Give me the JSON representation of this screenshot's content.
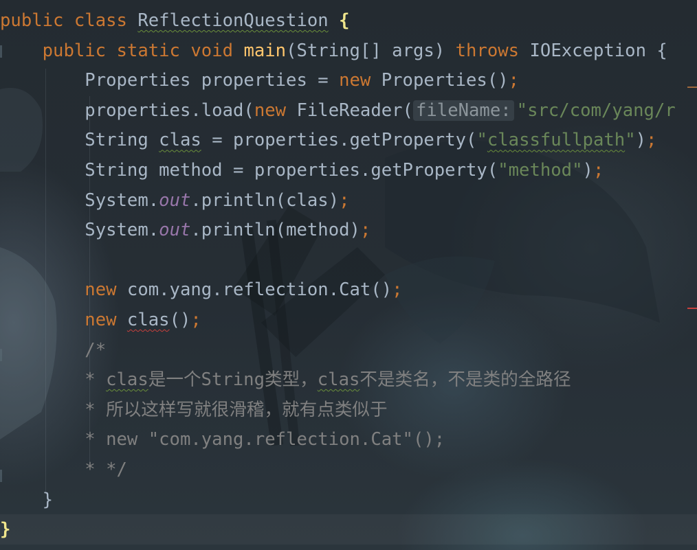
{
  "editor": {
    "lines": [
      {
        "indent": "",
        "tokens": [
          {
            "t": "public ",
            "c": "kw"
          },
          {
            "t": "class ",
            "c": "kw"
          },
          {
            "t": "ReflectionQuestion",
            "c": "plain",
            "u": "typo"
          },
          {
            "t": " ",
            "c": "plain"
          },
          {
            "t": "{",
            "c": "brace"
          }
        ]
      },
      {
        "indent": "    ",
        "tokens": [
          {
            "t": "public ",
            "c": "kw"
          },
          {
            "t": "static ",
            "c": "kw"
          },
          {
            "t": "void ",
            "c": "kw"
          },
          {
            "t": "main",
            "c": "method"
          },
          {
            "t": "(String[] args) ",
            "c": "plain"
          },
          {
            "t": "throws ",
            "c": "kw"
          },
          {
            "t": "IOException {",
            "c": "plain"
          }
        ]
      },
      {
        "indent": "        ",
        "tokens": [
          {
            "t": "Properties properties = ",
            "c": "plain"
          },
          {
            "t": "new ",
            "c": "kw"
          },
          {
            "t": "Properties()",
            "c": "plain"
          },
          {
            "t": ";",
            "c": "kw"
          }
        ]
      },
      {
        "indent": "        ",
        "tokens": [
          {
            "t": "properties.load(",
            "c": "plain"
          },
          {
            "t": "new ",
            "c": "kw"
          },
          {
            "t": "FileReader(",
            "c": "plain"
          },
          {
            "t": "fileName:",
            "c": "hint"
          },
          {
            "t": "\"src/com/yang/r",
            "c": "str"
          }
        ]
      },
      {
        "indent": "        ",
        "tokens": [
          {
            "t": "String ",
            "c": "plain"
          },
          {
            "t": "clas",
            "c": "plain",
            "u": "typo"
          },
          {
            "t": " = properties.getProperty(",
            "c": "plain"
          },
          {
            "t": "\"",
            "c": "str"
          },
          {
            "t": "classfullpath",
            "c": "str",
            "u": "typo"
          },
          {
            "t": "\"",
            "c": "str"
          },
          {
            "t": ")",
            "c": "plain"
          },
          {
            "t": ";",
            "c": "kw"
          }
        ]
      },
      {
        "indent": "        ",
        "tokens": [
          {
            "t": "String method = properties.getProperty(",
            "c": "plain"
          },
          {
            "t": "\"method\"",
            "c": "str"
          },
          {
            "t": ")",
            "c": "plain"
          },
          {
            "t": ";",
            "c": "kw"
          }
        ]
      },
      {
        "indent": "        ",
        "tokens": [
          {
            "t": "System.",
            "c": "plain"
          },
          {
            "t": "out",
            "c": "static"
          },
          {
            "t": ".println(clas)",
            "c": "plain"
          },
          {
            "t": ";",
            "c": "kw"
          }
        ]
      },
      {
        "indent": "        ",
        "tokens": [
          {
            "t": "System.",
            "c": "plain"
          },
          {
            "t": "out",
            "c": "static"
          },
          {
            "t": ".println(method)",
            "c": "plain"
          },
          {
            "t": ";",
            "c": "kw"
          }
        ]
      },
      {
        "indent": "",
        "tokens": []
      },
      {
        "indent": "        ",
        "tokens": [
          {
            "t": "new ",
            "c": "kw"
          },
          {
            "t": "com.yang.reflection.Cat()",
            "c": "plain"
          },
          {
            "t": ";",
            "c": "kw"
          }
        ]
      },
      {
        "indent": "        ",
        "tokens": [
          {
            "t": "new ",
            "c": "kw"
          },
          {
            "t": "clas",
            "c": "plain",
            "u": "err"
          },
          {
            "t": "()",
            "c": "plain"
          },
          {
            "t": ";",
            "c": "kw"
          }
        ]
      },
      {
        "indent": "        ",
        "tokens": [
          {
            "t": "/*",
            "c": "comment"
          }
        ]
      },
      {
        "indent": "        ",
        "tokens": [
          {
            "t": "* ",
            "c": "comment"
          },
          {
            "t": "clas",
            "c": "comment",
            "u": "typo"
          },
          {
            "t": "是一个String类型，",
            "c": "comment"
          },
          {
            "t": "clas",
            "c": "comment",
            "u": "typo"
          },
          {
            "t": "不是类名，不是类的全路径",
            "c": "comment"
          }
        ]
      },
      {
        "indent": "        ",
        "tokens": [
          {
            "t": "* 所以这样写就很滑稽，就有点类似于",
            "c": "comment"
          }
        ]
      },
      {
        "indent": "        ",
        "tokens": [
          {
            "t": "* new \"com.yang.reflection.Cat\"();",
            "c": "comment"
          }
        ]
      },
      {
        "indent": "        ",
        "tokens": [
          {
            "t": "* */",
            "c": "comment"
          }
        ]
      },
      {
        "indent": "    ",
        "tokens": [
          {
            "t": "}",
            "c": "plain"
          }
        ]
      },
      {
        "indent": "",
        "tokens": [
          {
            "t": "}",
            "c": "brace"
          }
        ]
      }
    ]
  }
}
